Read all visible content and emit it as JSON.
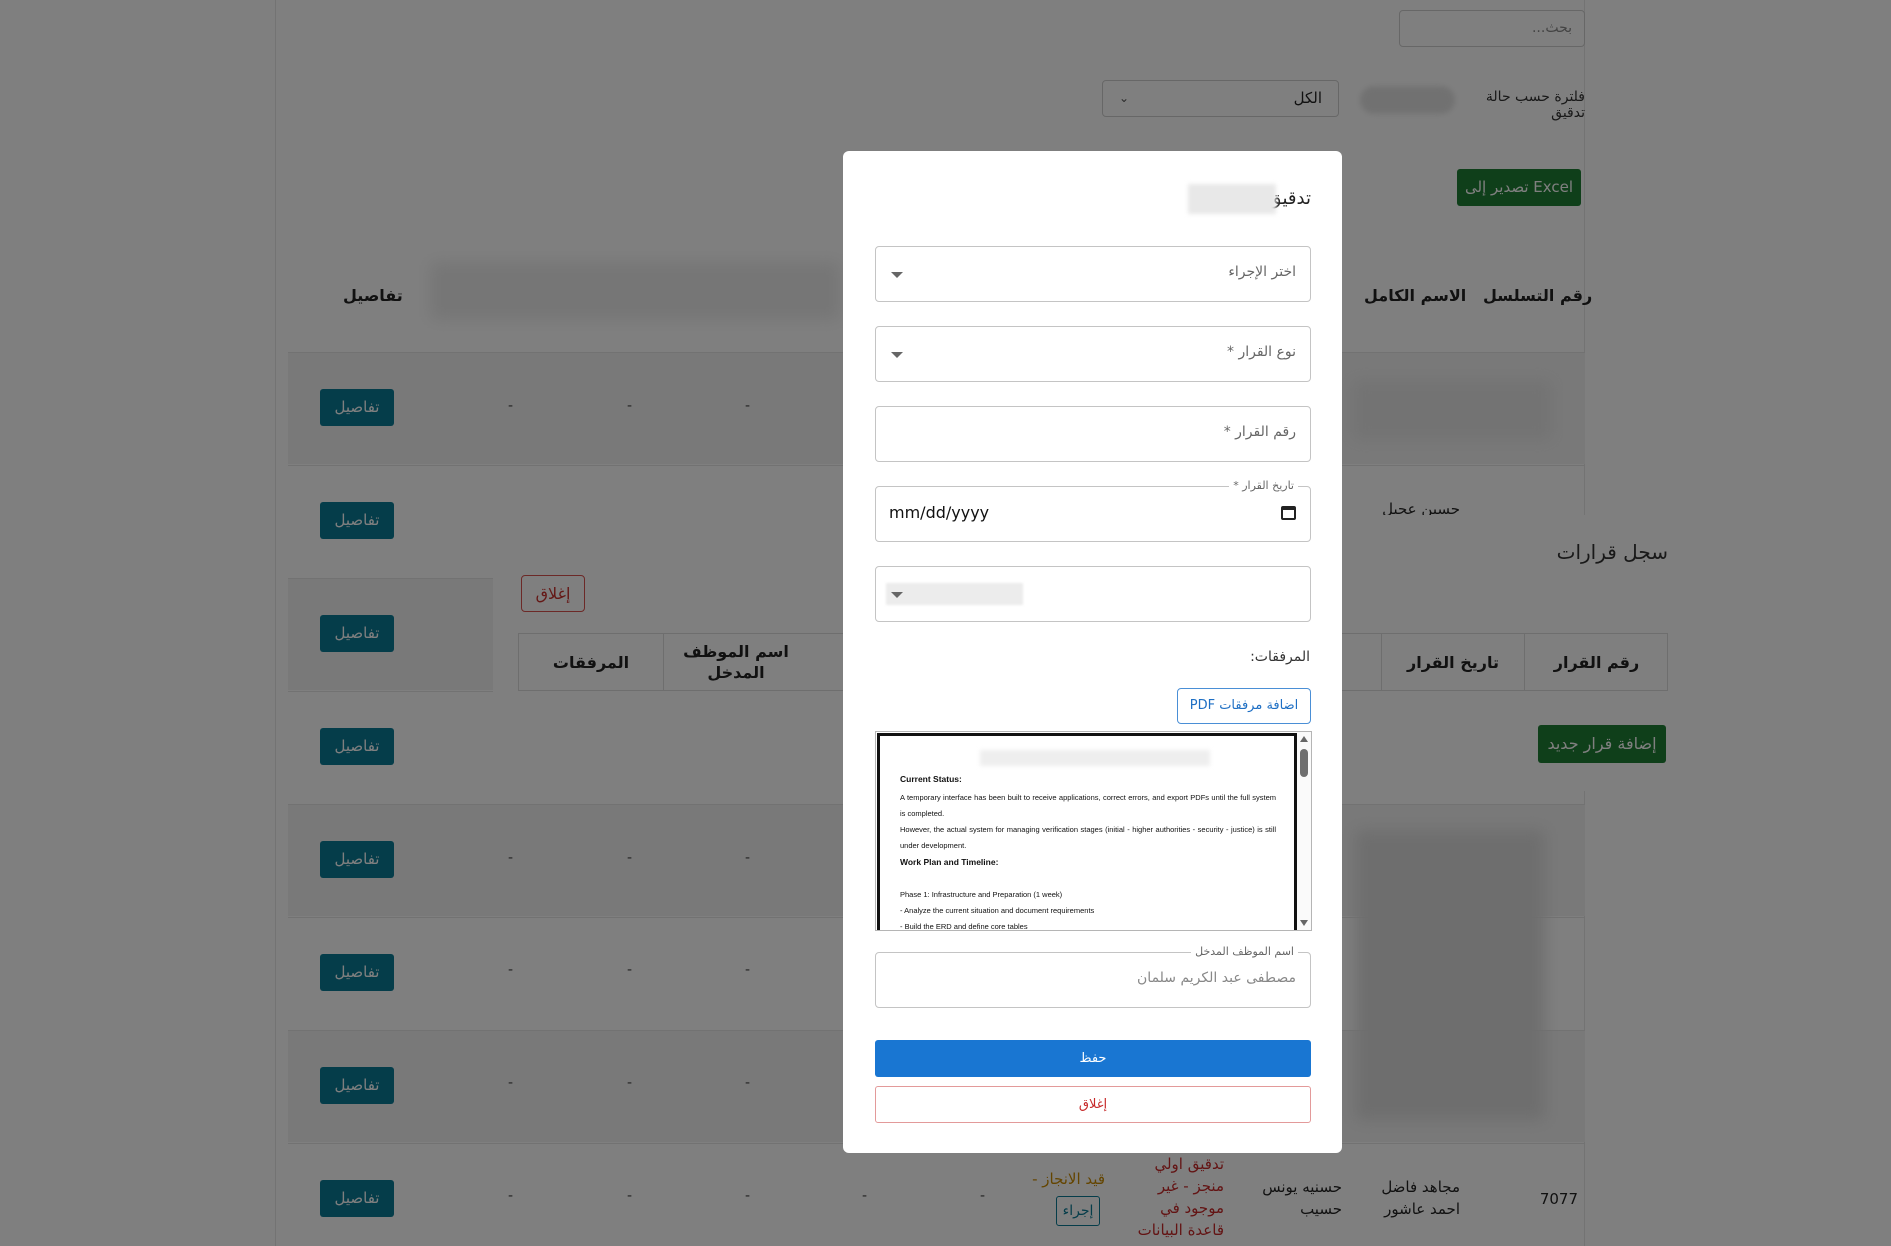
{
  "page": {
    "search_placeholder": "بحث...",
    "filter_label": "فلترة حسب حالة تدقيق",
    "filter_value": "الكل",
    "export_button": "تصدير إلى Excel",
    "columns": {
      "serial": "رقم التسلسل",
      "full_name": "الاسم الكامل",
      "details": "تفاصيل"
    },
    "details_button": "تفاصيل",
    "dash": "-",
    "row_partial_name": "حسين عجيل",
    "last_row": {
      "serial": "7077",
      "full_name": "مجاهد فاضل احمد عاشور",
      "mother_name": "حسنيه يونس حسيب",
      "status": "تدقيق اولي منجز - غير موجود في قاعدة البيانات",
      "progress": "قيد الانجاز -",
      "action_button": "إجراء"
    }
  },
  "log_modal": {
    "title": "سجل قرارات",
    "close_button": "إغلاق",
    "columns": {
      "decision_no": "رقم القرار",
      "decision_date": "تاريخ القرار",
      "partial": "رقم",
      "entry_employee": "اسم الموظف المدخل",
      "attachments": "المرفقات"
    },
    "add_button": "إضافة قرار جديد"
  },
  "dialog": {
    "title": "تدقيق",
    "action_select_placeholder": "اختر الإجراء",
    "decision_type_placeholder": "نوع القرار *",
    "decision_number_placeholder": "رقم القرار *",
    "decision_date_label": "تاريخ القرار *",
    "decision_date_value": "mm/dd/yyyy",
    "attachments_label": "المرفقات:",
    "add_pdf_button": "اضافة مرفقات PDF",
    "pdf_preview": {
      "heading_status": "Current Status:",
      "status_text_1": "A temporary interface has been built to receive applications, correct errors, and export PDFs until the full system is completed.",
      "status_text_2": "However, the actual system for managing verification stages (initial - higher authorities - security - justice) is still under development.",
      "heading_plan": "Work Plan and Timeline:",
      "phase_1": "Phase 1: Infrastructure and Preparation (1 week)",
      "step_1": "- Analyze the current situation and document requirements",
      "step_2": "- Build the ERD and define core tables"
    },
    "entry_employee_label": "اسم الموظف المدخل",
    "entry_employee_value": "مصطفى عبد الكريم سلمان",
    "save_button": "حفظ",
    "close_button": "إغلاق"
  },
  "colors": {
    "primary": "#1976d2",
    "success": "#1e7e34",
    "info": "#0b7a94",
    "danger": "#c62828"
  }
}
